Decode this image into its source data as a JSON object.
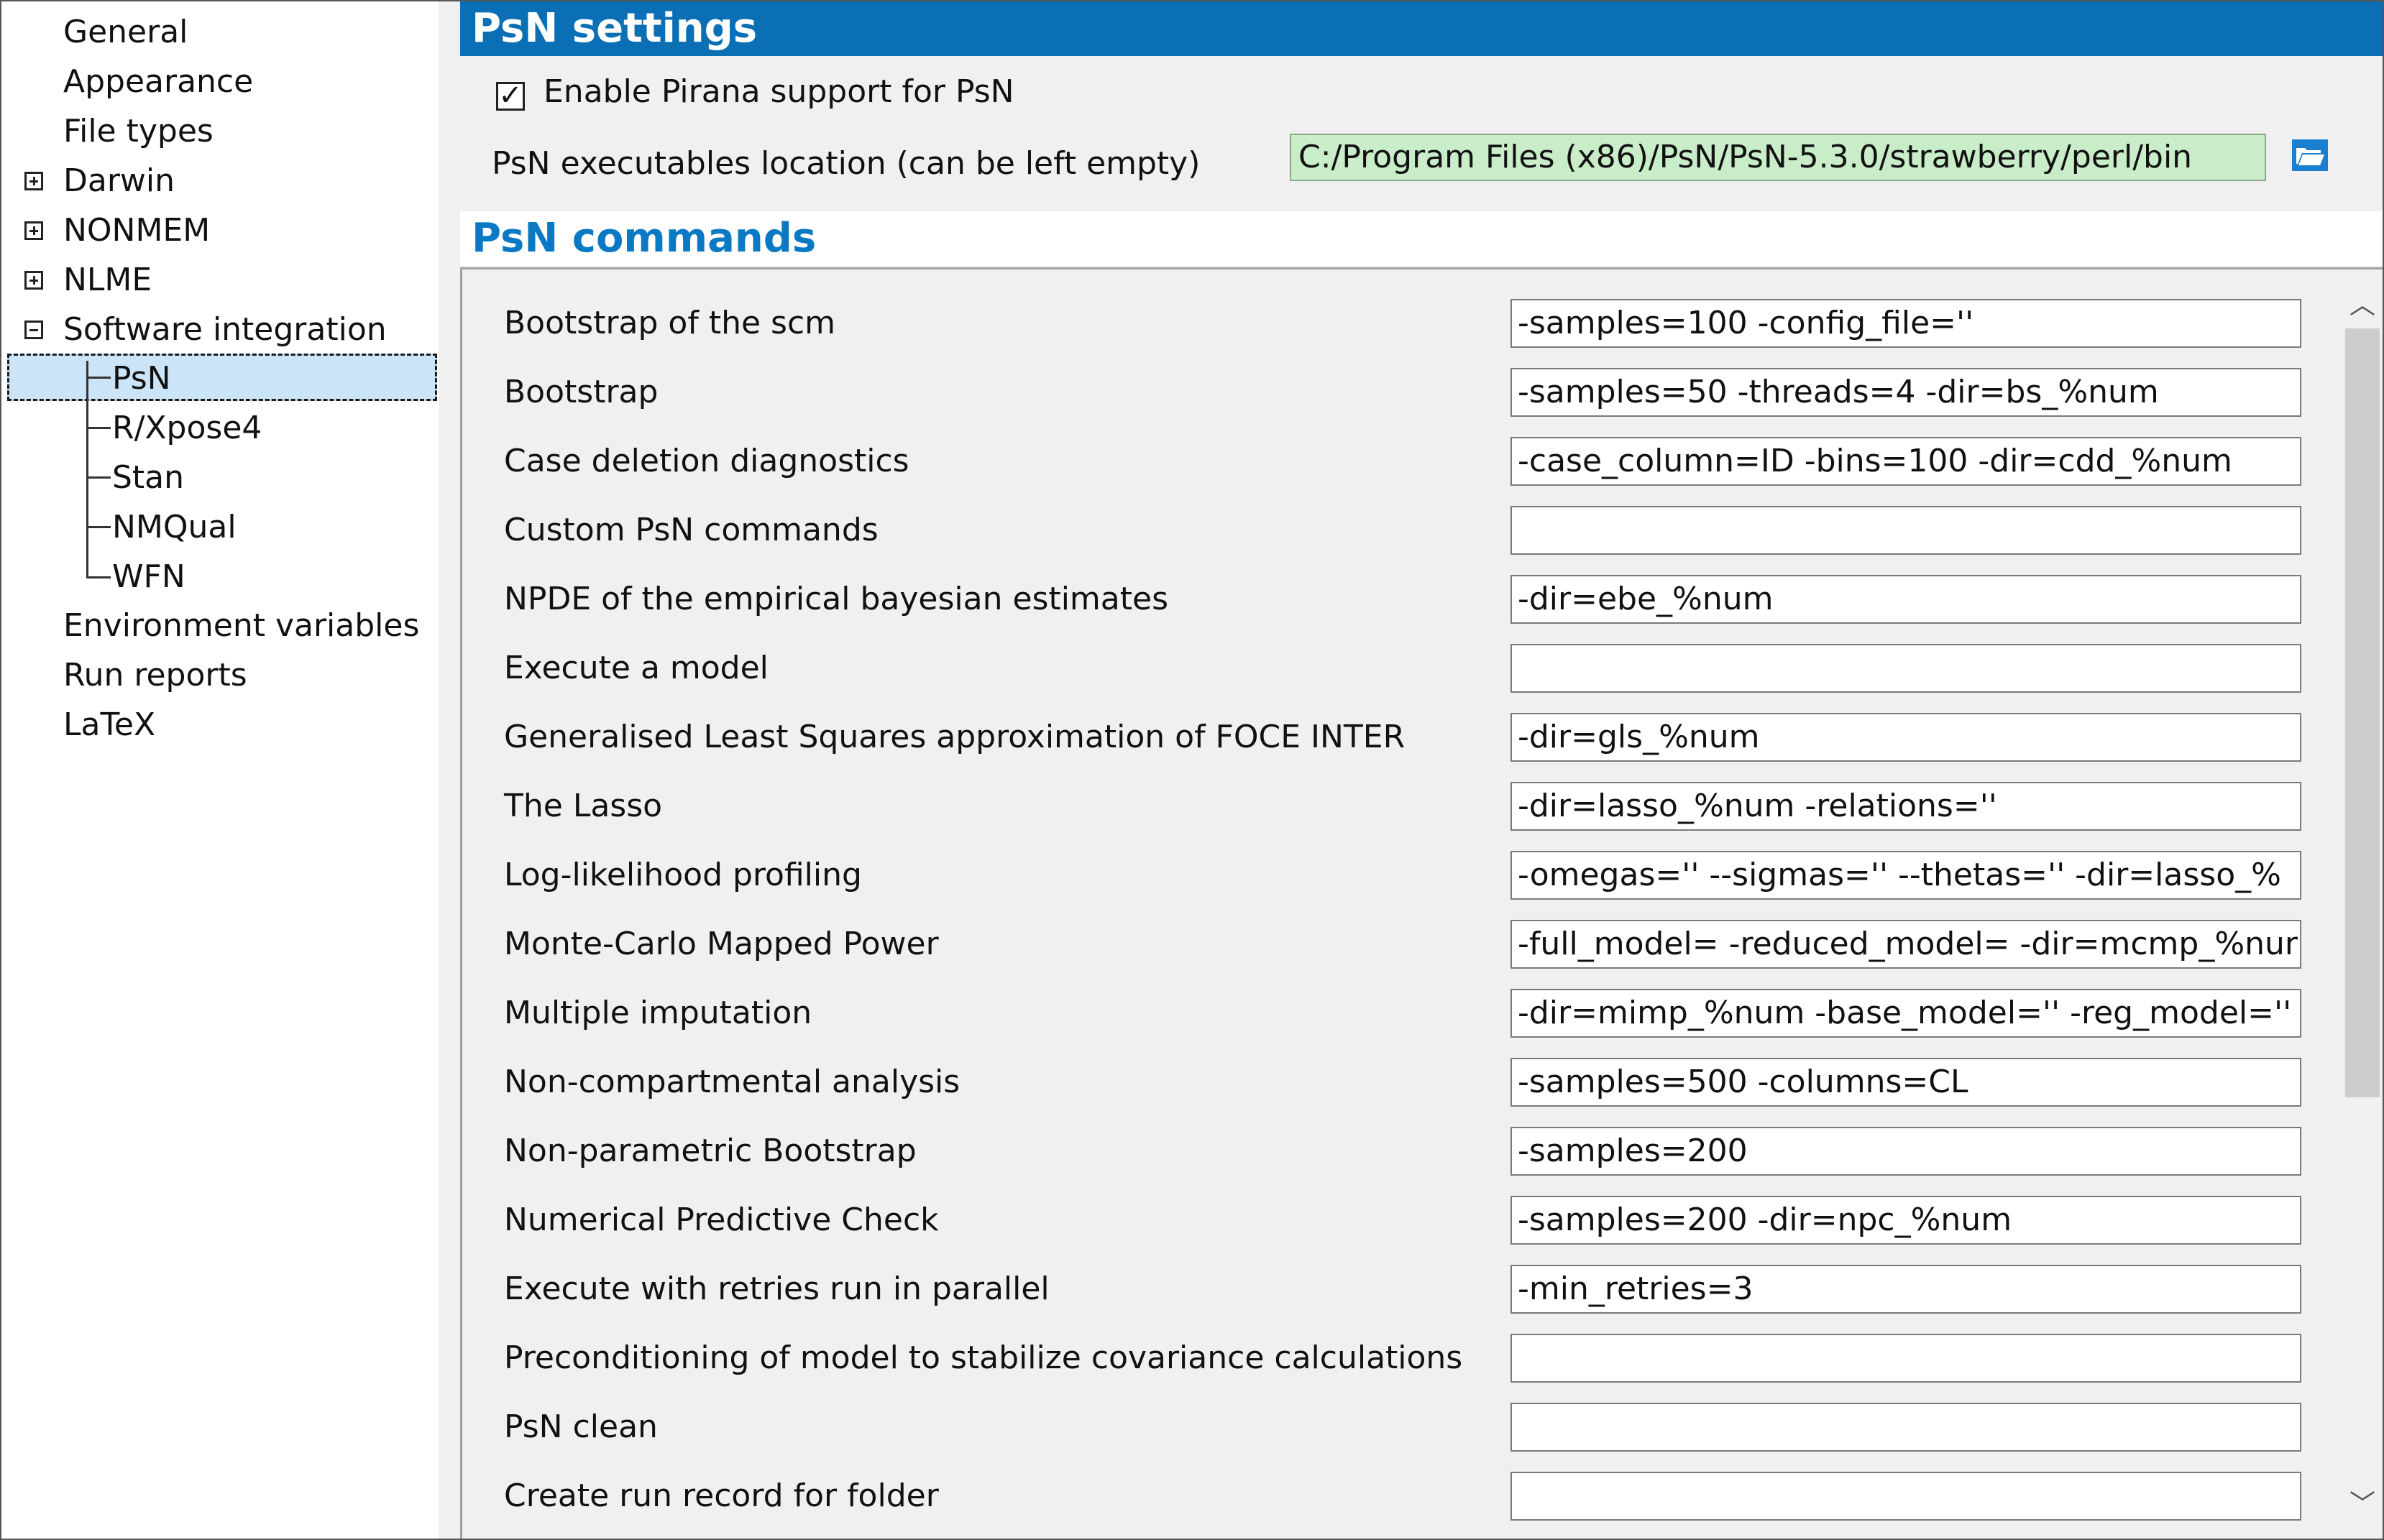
{
  "tree": {
    "items": [
      {
        "label": "General"
      },
      {
        "label": "Appearance"
      },
      {
        "label": "File types"
      },
      {
        "label": "Darwin",
        "expander": "plus"
      },
      {
        "label": "NONMEM",
        "expander": "plus"
      },
      {
        "label": "NLME",
        "expander": "plus"
      },
      {
        "label": "Software integration",
        "expander": "minus"
      },
      {
        "label": "PsN",
        "selected": true
      },
      {
        "label": "R/Xpose4"
      },
      {
        "label": "Stan"
      },
      {
        "label": "NMQual"
      },
      {
        "label": "WFN"
      },
      {
        "label": "Environment variables"
      },
      {
        "label": "Run reports"
      },
      {
        "label": "LaTeX"
      }
    ]
  },
  "settings": {
    "header": "PsN settings",
    "enable_label": "Enable Pirana support for PsN",
    "enable_checked": true,
    "check_glyph": "✓",
    "location_label": "PsN executables location (can be left empty)",
    "location_value": "C:/Program Files (x86)/PsN/PsN-5.3.0/strawberry/perl/bin",
    "folder_icon": "folder-open-icon"
  },
  "commands": {
    "header": "PsN commands",
    "rows": [
      {
        "label": "Bootstrap of the scm",
        "value": "-samples=100 -config_file=''"
      },
      {
        "label": "Bootstrap",
        "value": "-samples=50 -threads=4 -dir=bs_%num"
      },
      {
        "label": "Case deletion diagnostics",
        "value": "-case_column=ID -bins=100 -dir=cdd_%num"
      },
      {
        "label": "Custom PsN commands",
        "value": ""
      },
      {
        "label": "NPDE of the empirical bayesian estimates",
        "value": "-dir=ebe_%num"
      },
      {
        "label": "Execute a model",
        "value": ""
      },
      {
        "label": "Generalised Least Squares approximation of FOCE INTER",
        "value": "-dir=gls_%num"
      },
      {
        "label": "The Lasso",
        "value": "-dir=lasso_%num -relations=''"
      },
      {
        "label": "Log-likelihood profiling",
        "value": "-omegas='' --sigmas='' --thetas='' -dir=lasso_%"
      },
      {
        "label": "Monte-Carlo Mapped Power",
        "value": "-full_model= -reduced_model= -dir=mcmp_%nur"
      },
      {
        "label": "Multiple imputation",
        "value": "-dir=mimp_%num -base_model='' -reg_model=''"
      },
      {
        "label": "Non-compartmental analysis",
        "value": "-samples=500 -columns=CL"
      },
      {
        "label": "Non-parametric Bootstrap",
        "value": "-samples=200"
      },
      {
        "label": "Numerical Predictive Check",
        "value": "-samples=200 -dir=npc_%num"
      },
      {
        "label": "Execute with retries run in parallel",
        "value": "-min_retries=3"
      },
      {
        "label": "Preconditioning of model to stabilize covariance calculations",
        "value": ""
      },
      {
        "label": "PsN clean",
        "value": ""
      },
      {
        "label": "Create run record for folder",
        "value": ""
      }
    ]
  },
  "scrollbar": {
    "up_glyph": "︿",
    "down_glyph": "﹀"
  },
  "colors": {
    "header_blue": "#0a6fb4",
    "commands_title": "#0a79c4",
    "selected_bg": "#cce4f7",
    "location_bg": "#c9ecc9",
    "folder_icon": "#1a7fd0"
  }
}
